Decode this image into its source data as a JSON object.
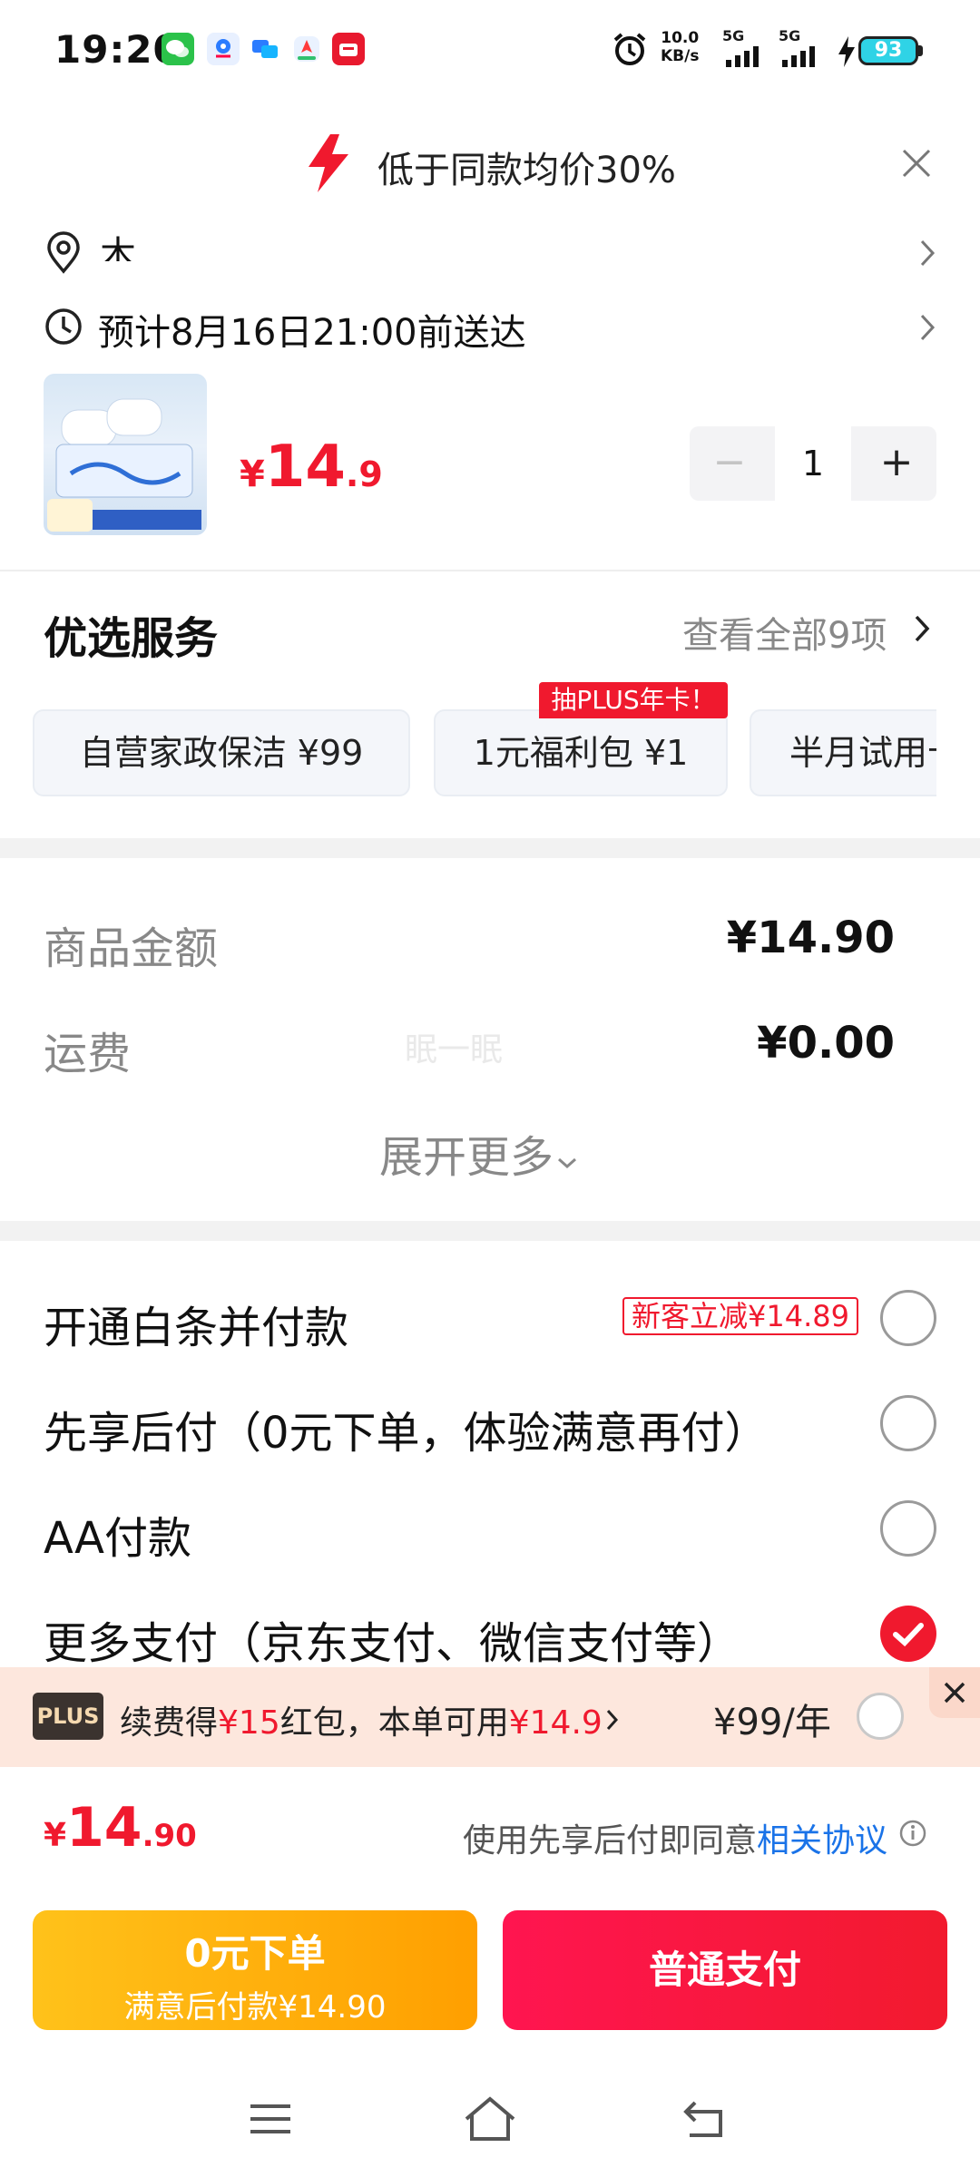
{
  "status_bar": {
    "time": "19:20",
    "net_speed_value": "10.0",
    "net_speed_unit": "KB/s",
    "sig1": "5G",
    "sig2": "5G",
    "battery": "93",
    "notification_icons": [
      "wechat-icon",
      "map-pin-app-icon",
      "chat-app-icon",
      "navigation-app-icon",
      "shopping-app-icon"
    ]
  },
  "promo_banner": {
    "text": "低于同款均价30%"
  },
  "delivery": {
    "address": "木",
    "eta": "预计8月16日21:00前送达"
  },
  "product": {
    "price_currency": "¥",
    "price_int": "14",
    "price_dec": ".9",
    "quantity": "1",
    "minus_label": "−",
    "plus_label": "+"
  },
  "services": {
    "title": "优选服务",
    "view_all": "查看全部9项",
    "tag": "抽PLUS年卡！",
    "cards": [
      {
        "label": "自营家政保洁  ¥99"
      },
      {
        "label": "1元福利包  ¥1"
      },
      {
        "label": "半月试用卡"
      }
    ]
  },
  "fees": {
    "goods_label": "商品金额",
    "goods_value": "¥14.90",
    "shipping_label": "运费",
    "shipping_value": "¥0.00",
    "watermark": "眠一眠",
    "expand": "展开更多"
  },
  "payment": {
    "options": [
      {
        "label": "开通白条并付款",
        "badge": "新客立减¥14.89",
        "selected": false
      },
      {
        "label": "先享后付（0元下单，体验满意再付）",
        "selected": false
      },
      {
        "label": "AA付款",
        "selected": false
      },
      {
        "label": "更多支付（京东支付、微信支付等）",
        "selected": true
      }
    ]
  },
  "plus_offer": {
    "badge": "PLUS",
    "text_a": "续费得",
    "text_b": "¥15",
    "text_c": "红包，本单可用",
    "text_d": "¥14.9",
    "price": "¥99/年"
  },
  "footer": {
    "total_currency": "¥",
    "total_int": "14",
    "total_dec": ".90",
    "agree_prefix": "使用先享后付即同意",
    "agree_link": "相关协议",
    "btn_left_line1": "0元下单",
    "btn_left_line2": "满意后付款¥14.90",
    "btn_right": "普通支付"
  },
  "colors": {
    "accent_red": "#f0192e",
    "link_blue": "#1a73e8",
    "btn_yellow": "#ffb000",
    "plus_bg": "#fde7dd"
  }
}
